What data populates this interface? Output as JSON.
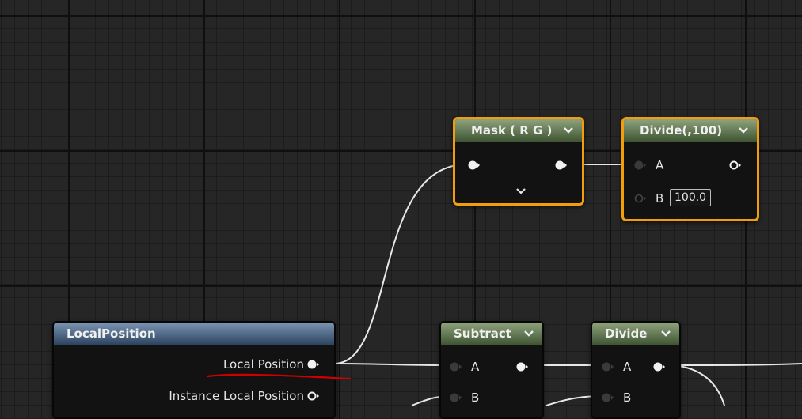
{
  "nodes": {
    "mask": {
      "title": "Mask ( R G )"
    },
    "divide_top": {
      "title": "Divide(,100)",
      "pin_a": "A",
      "pin_b": "B",
      "b_value": "100.0"
    },
    "local_position": {
      "title": "LocalPosition",
      "out1": "Local Position",
      "out2": "Instance Local Position"
    },
    "subtract": {
      "title": "Subtract",
      "pin_a": "A",
      "pin_b": "B"
    },
    "divide_bottom": {
      "title": "Divide",
      "pin_a": "A",
      "pin_b": "B"
    }
  },
  "colors": {
    "selection_outline": "#f29d0c",
    "wire": "#e8e8e8",
    "annotation_underline": "#d00000"
  }
}
